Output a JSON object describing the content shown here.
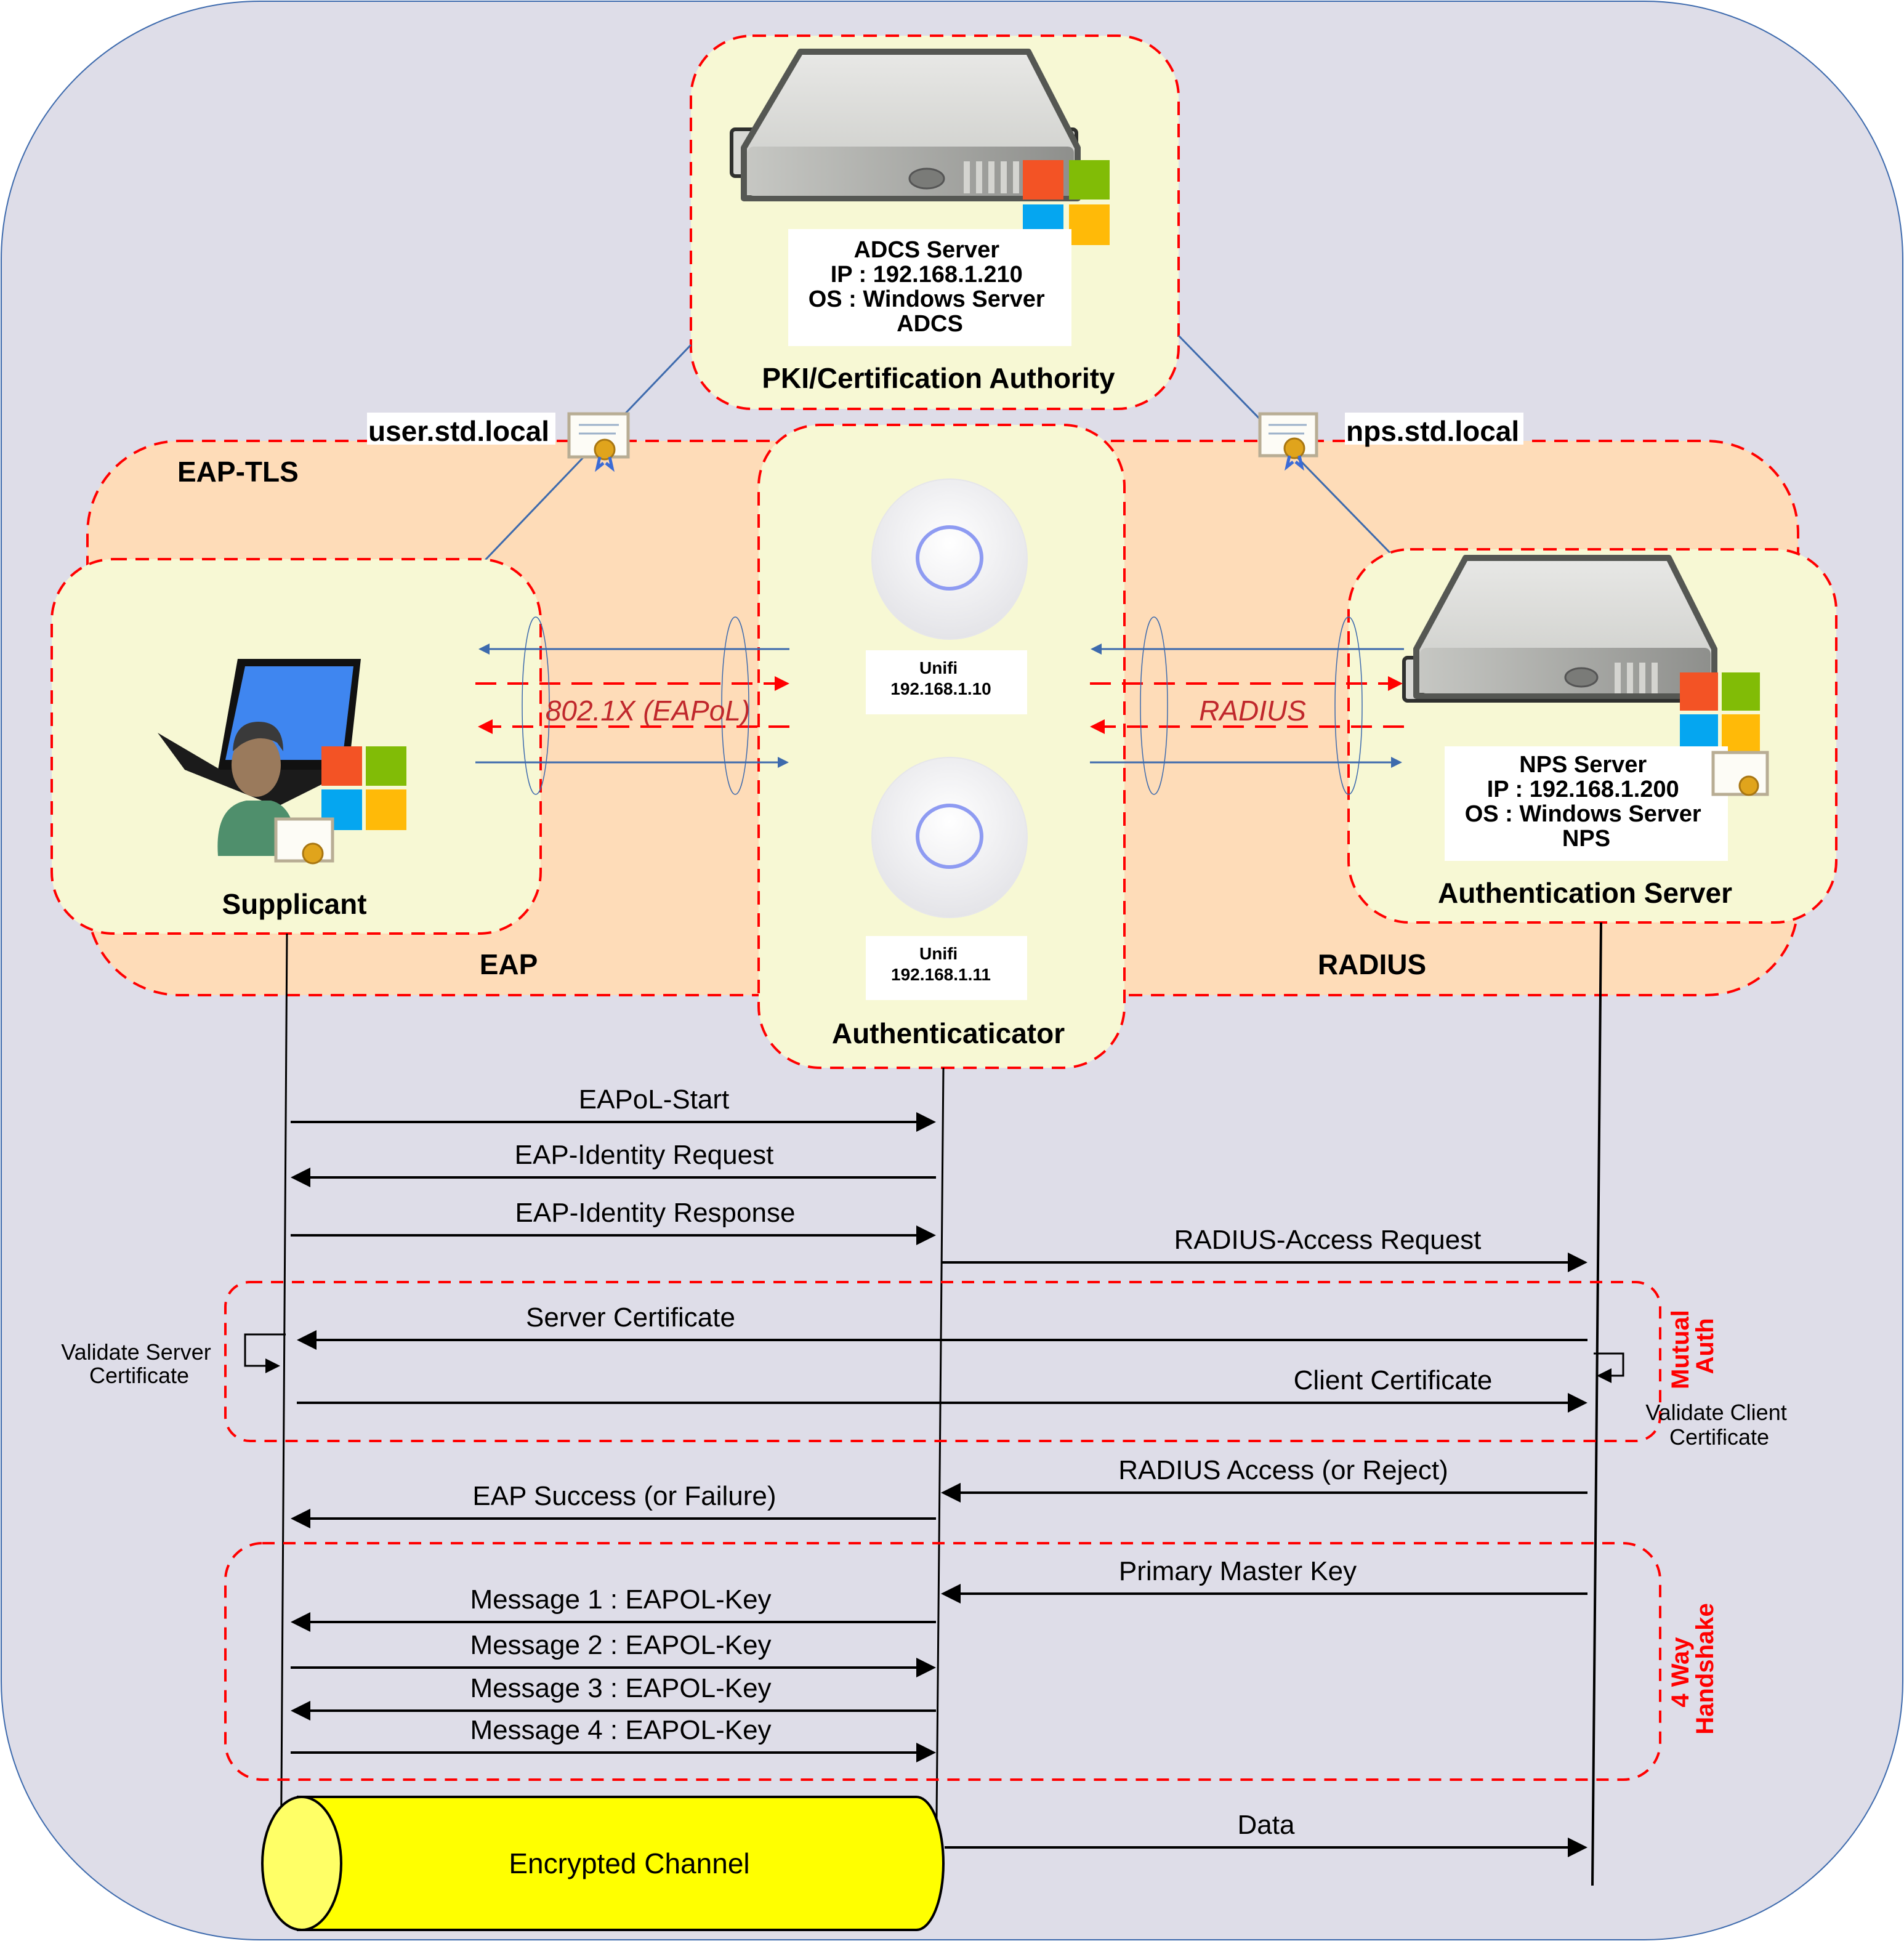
{
  "colors": {
    "background": "#dedde8",
    "zone_fill": "#fedcb8",
    "node_fill": "#f7f8d4",
    "dash_red": "#ff0000",
    "link_blue": "#3d6aad",
    "protocol_red": "#c0282c",
    "channel_yellow": "#ffff00"
  },
  "pki": {
    "box_lines": [
      "ADCS Server",
      "IP : 192.168.1.210",
      "OS : Windows Server",
      "ADCS"
    ],
    "title": "PKI/Certification Authority"
  },
  "certs": {
    "user": "user.std.local",
    "nps": "nps.std.local"
  },
  "zone": {
    "title": "EAP-TLS",
    "left_label": "EAP",
    "right_label": "RADIUS"
  },
  "supplicant": {
    "title": "Supplicant"
  },
  "authenticator": {
    "title": "Authenticaticator",
    "ap1": [
      "Unifi",
      "192.168.1.10"
    ],
    "ap2": [
      "Unifi",
      "192.168.1.11"
    ]
  },
  "auth_server": {
    "box_lines": [
      "NPS Server",
      "IP : 192.168.1.200",
      "OS : Windows Server",
      "NPS"
    ],
    "title": "Authentication Server"
  },
  "protocols": {
    "left": "802.1X (EAPoL)",
    "right": "RADIUS"
  },
  "sequence": {
    "messages": [
      {
        "label": "EAPoL-Start",
        "from": "supplicant",
        "to": "authenticator"
      },
      {
        "label": "EAP-Identity Request",
        "from": "authenticator",
        "to": "supplicant"
      },
      {
        "label": "EAP-Identity Response",
        "from": "supplicant",
        "to": "authenticator"
      },
      {
        "label": "RADIUS-Access Request",
        "from": "authenticator",
        "to": "server"
      },
      {
        "label": "Server Certificate",
        "from": "server",
        "to": "supplicant"
      },
      {
        "label": "Client Certificate",
        "from": "supplicant",
        "to": "server"
      },
      {
        "label": "RADIUS Access (or Reject)",
        "from": "server",
        "to": "authenticator"
      },
      {
        "label": "EAP Success (or Failure)",
        "from": "authenticator",
        "to": "supplicant"
      },
      {
        "label": "Primary Master Key",
        "from": "server",
        "to": "authenticator"
      },
      {
        "label": "Message 1 : EAPOL-Key",
        "from": "authenticator",
        "to": "supplicant"
      },
      {
        "label": "Message 2 : EAPOL-Key",
        "from": "supplicant",
        "to": "authenticator"
      },
      {
        "label": "Message 3 : EAPOL-Key",
        "from": "authenticator",
        "to": "supplicant"
      },
      {
        "label": "Message 4 : EAPOL-Key",
        "from": "supplicant",
        "to": "authenticator"
      },
      {
        "label": "Data",
        "from": "authenticator",
        "to": "server"
      }
    ],
    "validate_server": [
      "Validate Server",
      "Certificate"
    ],
    "validate_client": [
      "Validate Client",
      "Certificate"
    ],
    "group_mutual": [
      "Mutual",
      "Auth"
    ],
    "group_handshake": [
      "4 Way",
      "Handshake"
    ],
    "encrypted_channel": "Encrypted Channel"
  }
}
